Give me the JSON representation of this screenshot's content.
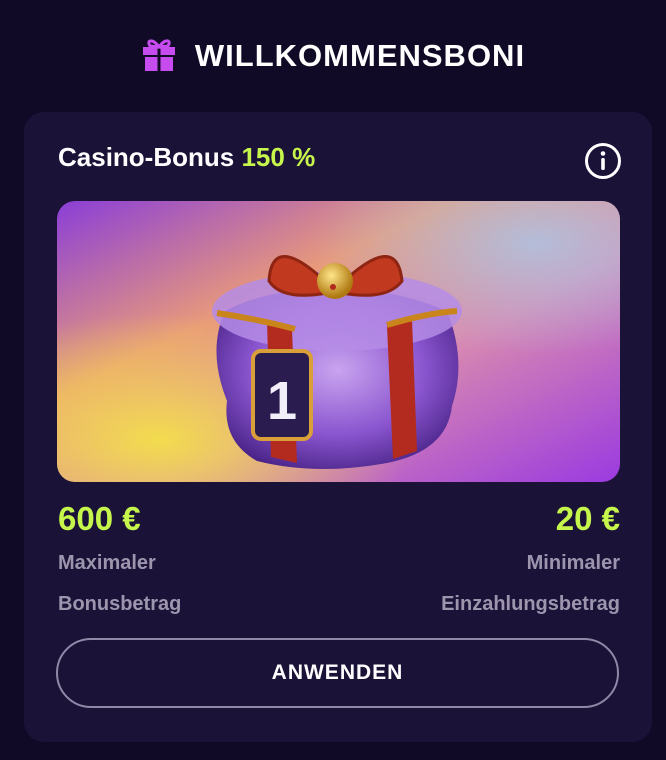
{
  "header": {
    "title": "WILLKOMMENSBONI",
    "icon": "gift-icon"
  },
  "bonus_card": {
    "title": "Casino-Bonus",
    "percentage": "150 %",
    "info_icon": "info-icon",
    "image_alt_number": "1",
    "max_bonus": {
      "value": "600 €",
      "label_line1": "Maximaler",
      "label_line2": "Bonusbetrag"
    },
    "min_deposit": {
      "value": "20 €",
      "label_line1": "Minimaler",
      "label_line2": "Einzahlungsbetrag"
    },
    "apply_label": "ANWENDEN"
  },
  "colors": {
    "background": "#110a26",
    "card": "#1b1238",
    "accent_green": "#c6f64b",
    "muted_text": "#9c95ad",
    "gift_purple": "#c64cf0"
  }
}
